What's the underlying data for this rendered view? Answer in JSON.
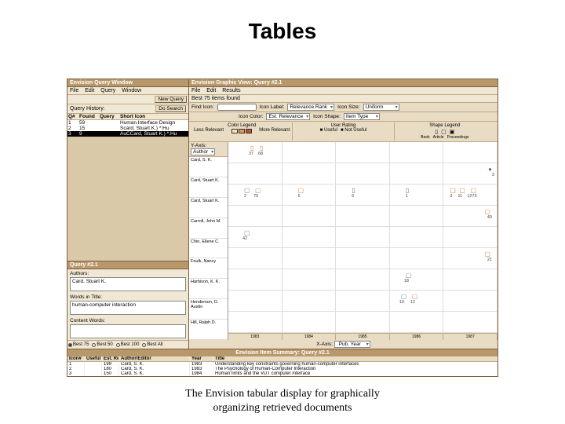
{
  "slide": {
    "title": "Tables",
    "caption_l1": "The Envision tabular display for graphically",
    "caption_l2": "organizing retrieved documents"
  },
  "left": {
    "title": "Envision Query Window",
    "menu": {
      "file": "File",
      "edit": "Edit",
      "query": "Query",
      "window": "Window"
    },
    "btn_new": "New Query",
    "qh_label": "Query History:",
    "btn_search": "Do Search",
    "cols": {
      "q": "Q#",
      "found": "Found",
      "query": "Query",
      "short": "Short Icon"
    },
    "rows": [
      {
        "q": "1",
        "found": "59",
        "short": "Human Interface Design"
      },
      {
        "q": "2",
        "found": "15",
        "short": "Scard, Stuart K.) *:Hu"
      },
      {
        "q": "3",
        "found": "9",
        "short": "AuCCard, Stuart K.) *:Hu"
      }
    ],
    "q_title": "Query #2.1",
    "authors_lbl": "Authors:",
    "authors_val": "Card, Stuart K.",
    "words_lbl": "Words in Title:",
    "words_val": "human-computer interaction",
    "content_lbl": "Content Words:",
    "content_val": "",
    "radios": {
      "r75": "Best 75",
      "r50": "Best 50",
      "r100": "Best 100",
      "rall": "Best All"
    }
  },
  "right": {
    "title": "Envision Graphic View: Query #2.1",
    "menu": {
      "file": "File",
      "edit": "Edit",
      "results": "Results"
    },
    "status": "Best 75 items found",
    "find_lbl": "Find Icon:",
    "icon_label_lbl": "Icon Label:",
    "icon_label_val": "Relevance Rank",
    "icon_size_lbl": "Icon Size:",
    "icon_size_val": "Uniform",
    "icon_color_lbl": "Icon Color:",
    "icon_color_val": "Est. Relevance",
    "icon_shape_lbl": "Icon Shape:",
    "icon_shape_val": "Item Type",
    "legend": {
      "color": {
        "t": "Color Legend",
        "a": "Less Relevant",
        "b": "More Relevant"
      },
      "rating": {
        "t": "User Rating",
        "a": "Useful",
        "b": "Not Useful"
      },
      "shape": {
        "t": "Shape Legend",
        "a": "Book",
        "b": "Article",
        "c": "Proceedings"
      }
    },
    "yaxis_lbl": "Y-Axis:",
    "yaxis_val": "Author",
    "xaxis_lbl": "X-Axis:",
    "xaxis_val": "Pub. Year",
    "y": [
      "Card, S. K.",
      "Card, Stuart K.",
      "Card, Stuart K.",
      "Carroll, John M.",
      "Chin, Ellene C.",
      "Foulk, Nancy",
      "Harbison, K. K.",
      "Henderson, D. Austin",
      "Hill, Ralph D."
    ],
    "x": [
      "1983",
      "1984",
      "1985",
      "1986",
      "1987"
    ]
  },
  "summary": {
    "title": "Envision Item Summary: Query #2.1",
    "cols": {
      "c1": "Icon#",
      "c2": "Useful",
      "c3": "Est. Rel",
      "c4": "Author/Editor",
      "c5": "Year",
      "c6": "Title"
    },
    "rows": [
      {
        "c1": "1",
        "c2": "",
        "c3": "199",
        "c4": "Card, S. K.",
        "c5": "1983",
        "c6": "Understanding key constraints governing human-computer interfaces"
      },
      {
        "c1": "2",
        "c2": "",
        "c3": "180",
        "c4": "Card, S. K.",
        "c5": "1983",
        "c6": "The Psychology of Human-Computer Interaction"
      },
      {
        "c1": "3",
        "c2": "",
        "c3": "150",
        "c4": "Card, S. K.",
        "c5": "1984",
        "c6": "Human limits and the VDT computer interface"
      }
    ]
  }
}
